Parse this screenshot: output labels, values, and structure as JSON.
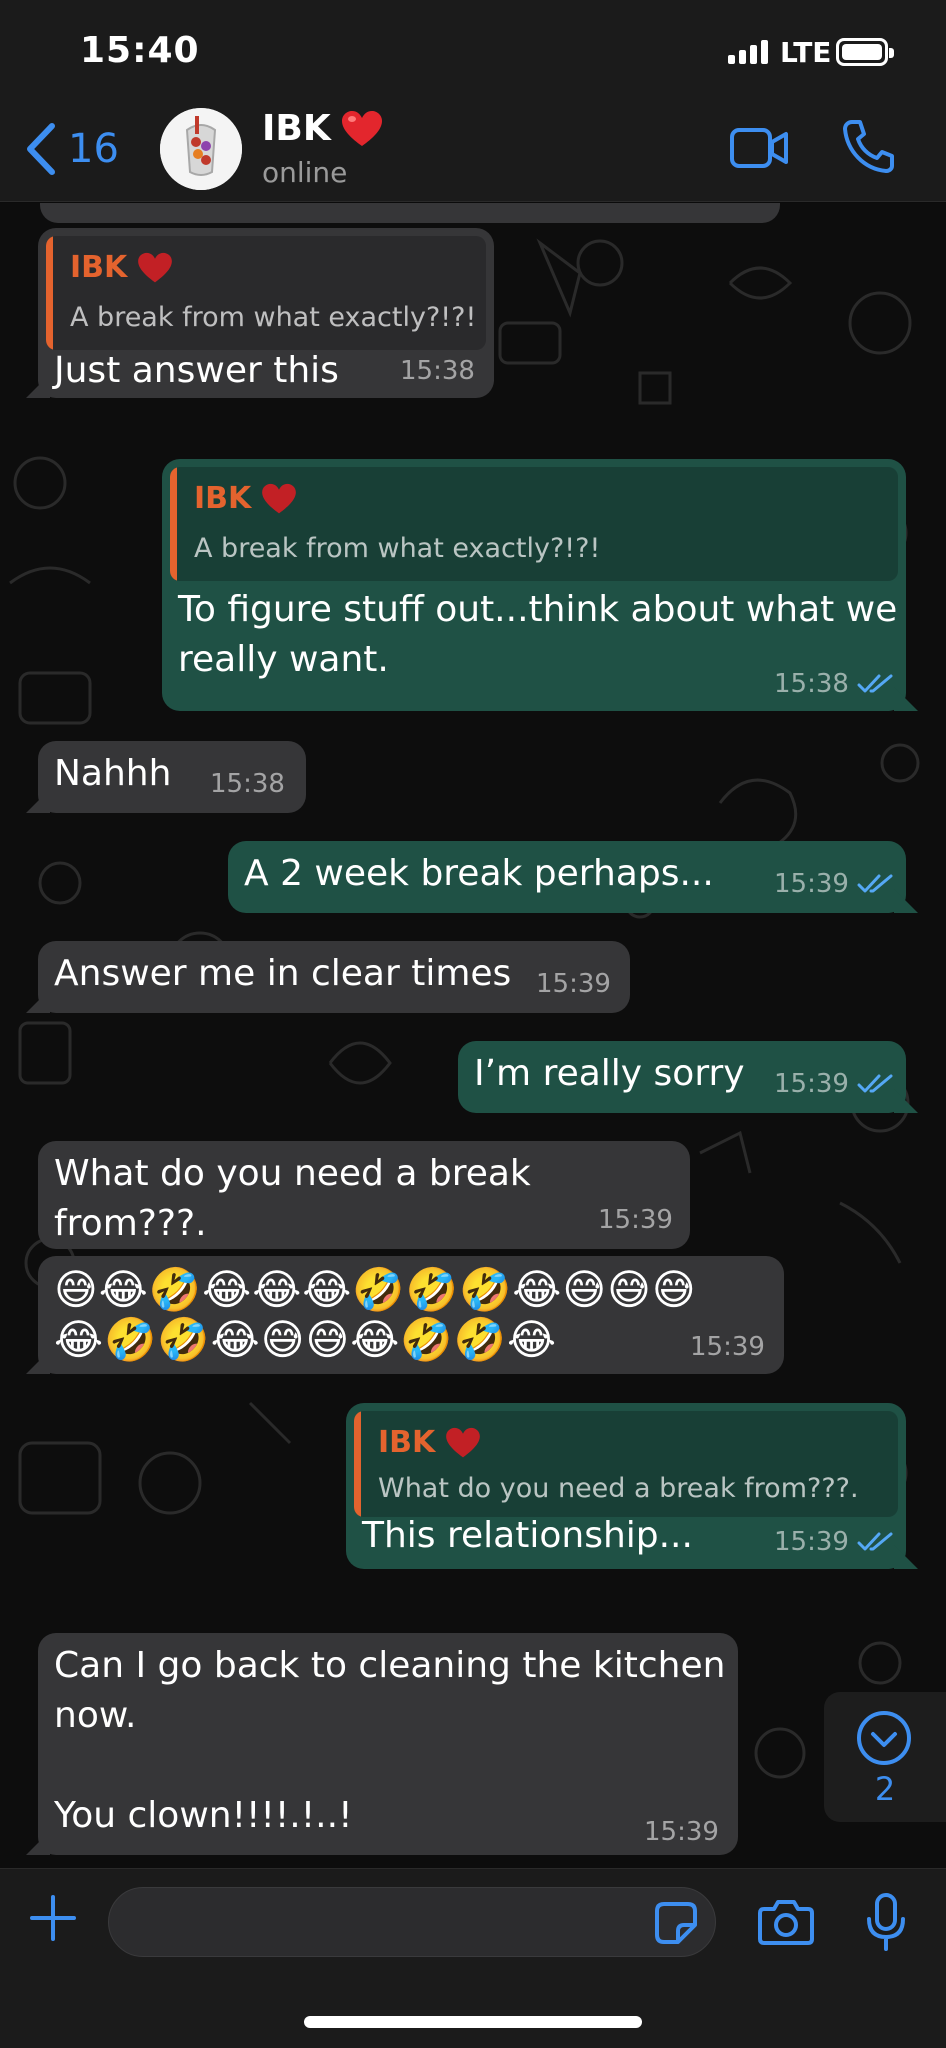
{
  "status_bar": {
    "time": "15:40",
    "network": "LTE"
  },
  "header": {
    "back_count": "16",
    "contact_name": "IBK",
    "contact_emoji": "❤️",
    "contact_status": "online"
  },
  "messages": [
    {
      "dir": "in",
      "quote_name": "IBK",
      "quote_text": "A break from what exactly?!?!",
      "text": "Just answer this",
      "time": "15:38"
    },
    {
      "dir": "out",
      "quote_name": "IBK",
      "quote_text": "A break from what exactly?!?!",
      "text_line1": "To figure stuff out...think about what we",
      "text_line2": "really want.",
      "time": "15:38"
    },
    {
      "dir": "in",
      "text": "Nahhh",
      "time": "15:38"
    },
    {
      "dir": "out",
      "text": "A 2 week break perhaps...",
      "time": "15:39"
    },
    {
      "dir": "in",
      "text": "Answer me in clear times",
      "time": "15:39"
    },
    {
      "dir": "out",
      "text": "I’m really sorry",
      "time": "15:39"
    },
    {
      "dir": "in",
      "text": "What do you need a break from???.",
      "time": "15:39"
    },
    {
      "dir": "in",
      "emoji_line1": "😅😂🤣😂😂😂🤣🤣🤣😂😅😅😅",
      "emoji_line2": "😂🤣🤣😂😅😅😂🤣🤣😂",
      "time": "15:39"
    },
    {
      "dir": "out",
      "quote_name": "IBK",
      "quote_text": "What do you need a break from???.",
      "text": "This relationship...",
      "time": "15:39"
    },
    {
      "dir": "in",
      "text_line1": "Can I go back to cleaning the kitchen",
      "text_line2": "now.",
      "text_line3": "You clown!!!!.!..!",
      "time": "15:39"
    }
  ],
  "scroll_button": {
    "unread_count": "2"
  },
  "input": {
    "placeholder": ""
  },
  "colors": {
    "accent": "#3d8ef0",
    "outgoing_bubble": "#1f5145",
    "incoming_bubble": "#363638",
    "quote_name": "#e4632e",
    "read_ticks": "#55a8f5"
  }
}
